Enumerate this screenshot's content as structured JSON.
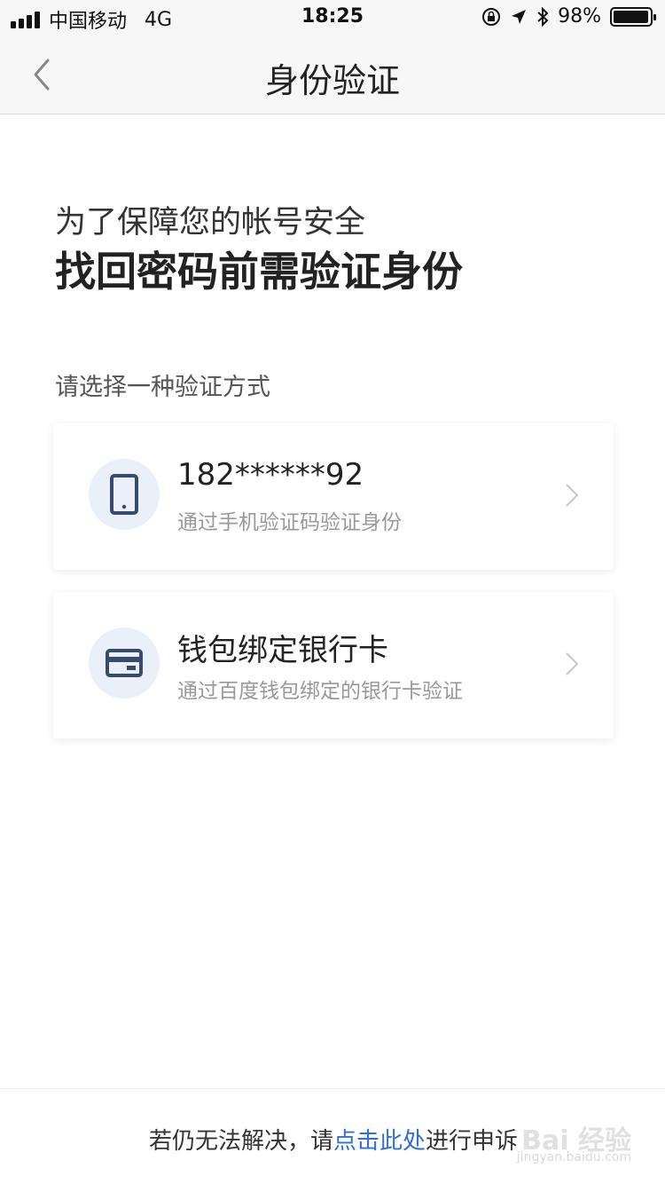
{
  "status_bar": {
    "carrier": "中国移动",
    "network": "4G",
    "time": "18:25",
    "battery": "98%",
    "battery_level": 0.98
  },
  "nav": {
    "title": "身份验证"
  },
  "header": {
    "line1": "为了保障您的帐号安全",
    "line2": "找回密码前需验证身份"
  },
  "section_label": "请选择一种验证方式",
  "options": [
    {
      "title": "182******92",
      "description": "通过手机验证码验证身份",
      "icon": "phone-icon"
    },
    {
      "title": "钱包绑定银行卡",
      "description": "通过百度钱包绑定的银行卡验证",
      "icon": "bank-card-icon"
    }
  ],
  "footer": {
    "prefix": "若仍无法解决，请",
    "link": "点击此处",
    "suffix": "进行申诉"
  },
  "watermark": {
    "logo": "Bai 经验",
    "url": "jingyan.baidu.com"
  },
  "colors": {
    "link": "#2f6fd6",
    "icon_bg": "#eaf0fa",
    "icon_fg": "#3a4a6b"
  }
}
